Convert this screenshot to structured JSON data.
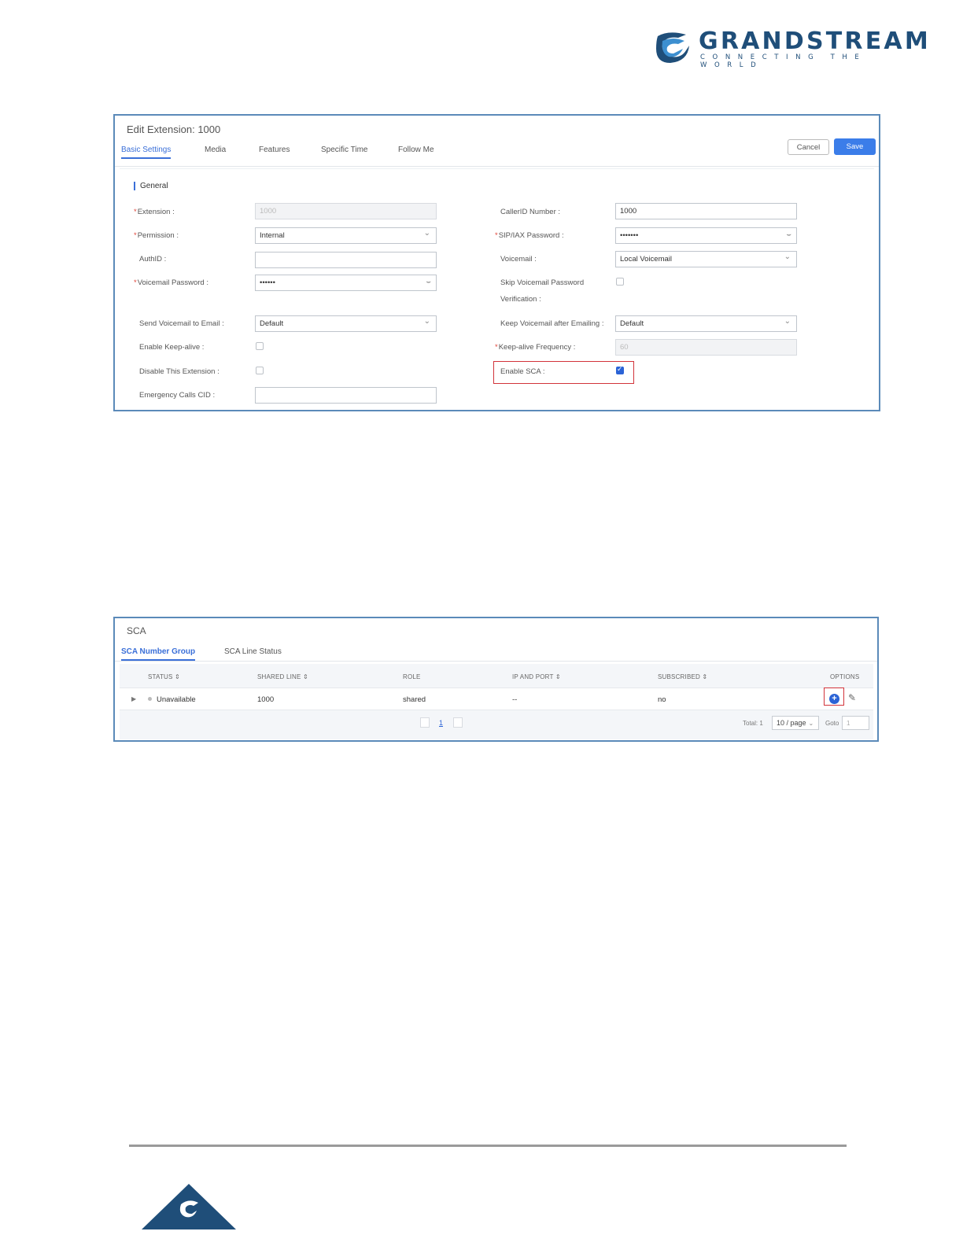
{
  "brand": {
    "name": "GRANDSTREAM",
    "tagline": "CONNECTING THE WORLD",
    "color": "#1f4e79"
  },
  "edit": {
    "title": "Edit Extension: 1000",
    "tabs": [
      "Basic Settings",
      "Media",
      "Features",
      "Specific Time",
      "Follow Me"
    ],
    "active_tab": "Basic Settings",
    "cancel_label": "Cancel",
    "save_label": "Save",
    "section": "General",
    "left": {
      "extension_label": "Extension :",
      "extension_value": "1000",
      "permission_label": "Permission :",
      "permission_value": "Internal",
      "authid_label": "AuthID :",
      "authid_value": "",
      "vm_password_label": "Voicemail Password :",
      "vm_password_value": "••••••",
      "send_vm_email_label": "Send Voicemail to Email :",
      "send_vm_email_value": "Default",
      "keepalive_label": "Enable Keep-alive :",
      "disable_ext_label": "Disable This Extension :",
      "emergency_cid_label": "Emergency Calls CID :",
      "emergency_cid_value": ""
    },
    "right": {
      "callerid_label": "CallerID Number :",
      "callerid_value": "1000",
      "sip_password_label": "SIP/IAX Password :",
      "sip_password_value": "•••••••",
      "voicemail_label": "Voicemail :",
      "voicemail_value": "Local Voicemail",
      "skip_vm_label_1": "Skip Voicemail Password",
      "skip_vm_label_2": "Verification :",
      "keep_vm_label": "Keep Voicemail after Emailing :",
      "keep_vm_value": "Default",
      "keepalive_freq_label": "Keep-alive Frequency :",
      "keepalive_freq_value": "60",
      "enable_sca_label": "Enable SCA :",
      "enable_sca_checked": true
    }
  },
  "sca": {
    "title": "SCA",
    "tabs": [
      "SCA Number Group",
      "SCA Line Status"
    ],
    "active_tab": "SCA Number Group",
    "columns": [
      "STATUS ⇕",
      "SHARED LINE ⇕",
      "ROLE",
      "IP AND PORT ⇕",
      "SUBSCRIBED ⇕",
      "OPTIONS"
    ],
    "rows": [
      {
        "status": "Unavailable",
        "shared_line": "1000",
        "role": "shared",
        "ip_port": "--",
        "subscribed": "no"
      }
    ],
    "pager": {
      "page": "1",
      "total": "Total: 1",
      "page_size": "10 / page",
      "goto_label": "Goto",
      "goto_value": "1"
    }
  }
}
